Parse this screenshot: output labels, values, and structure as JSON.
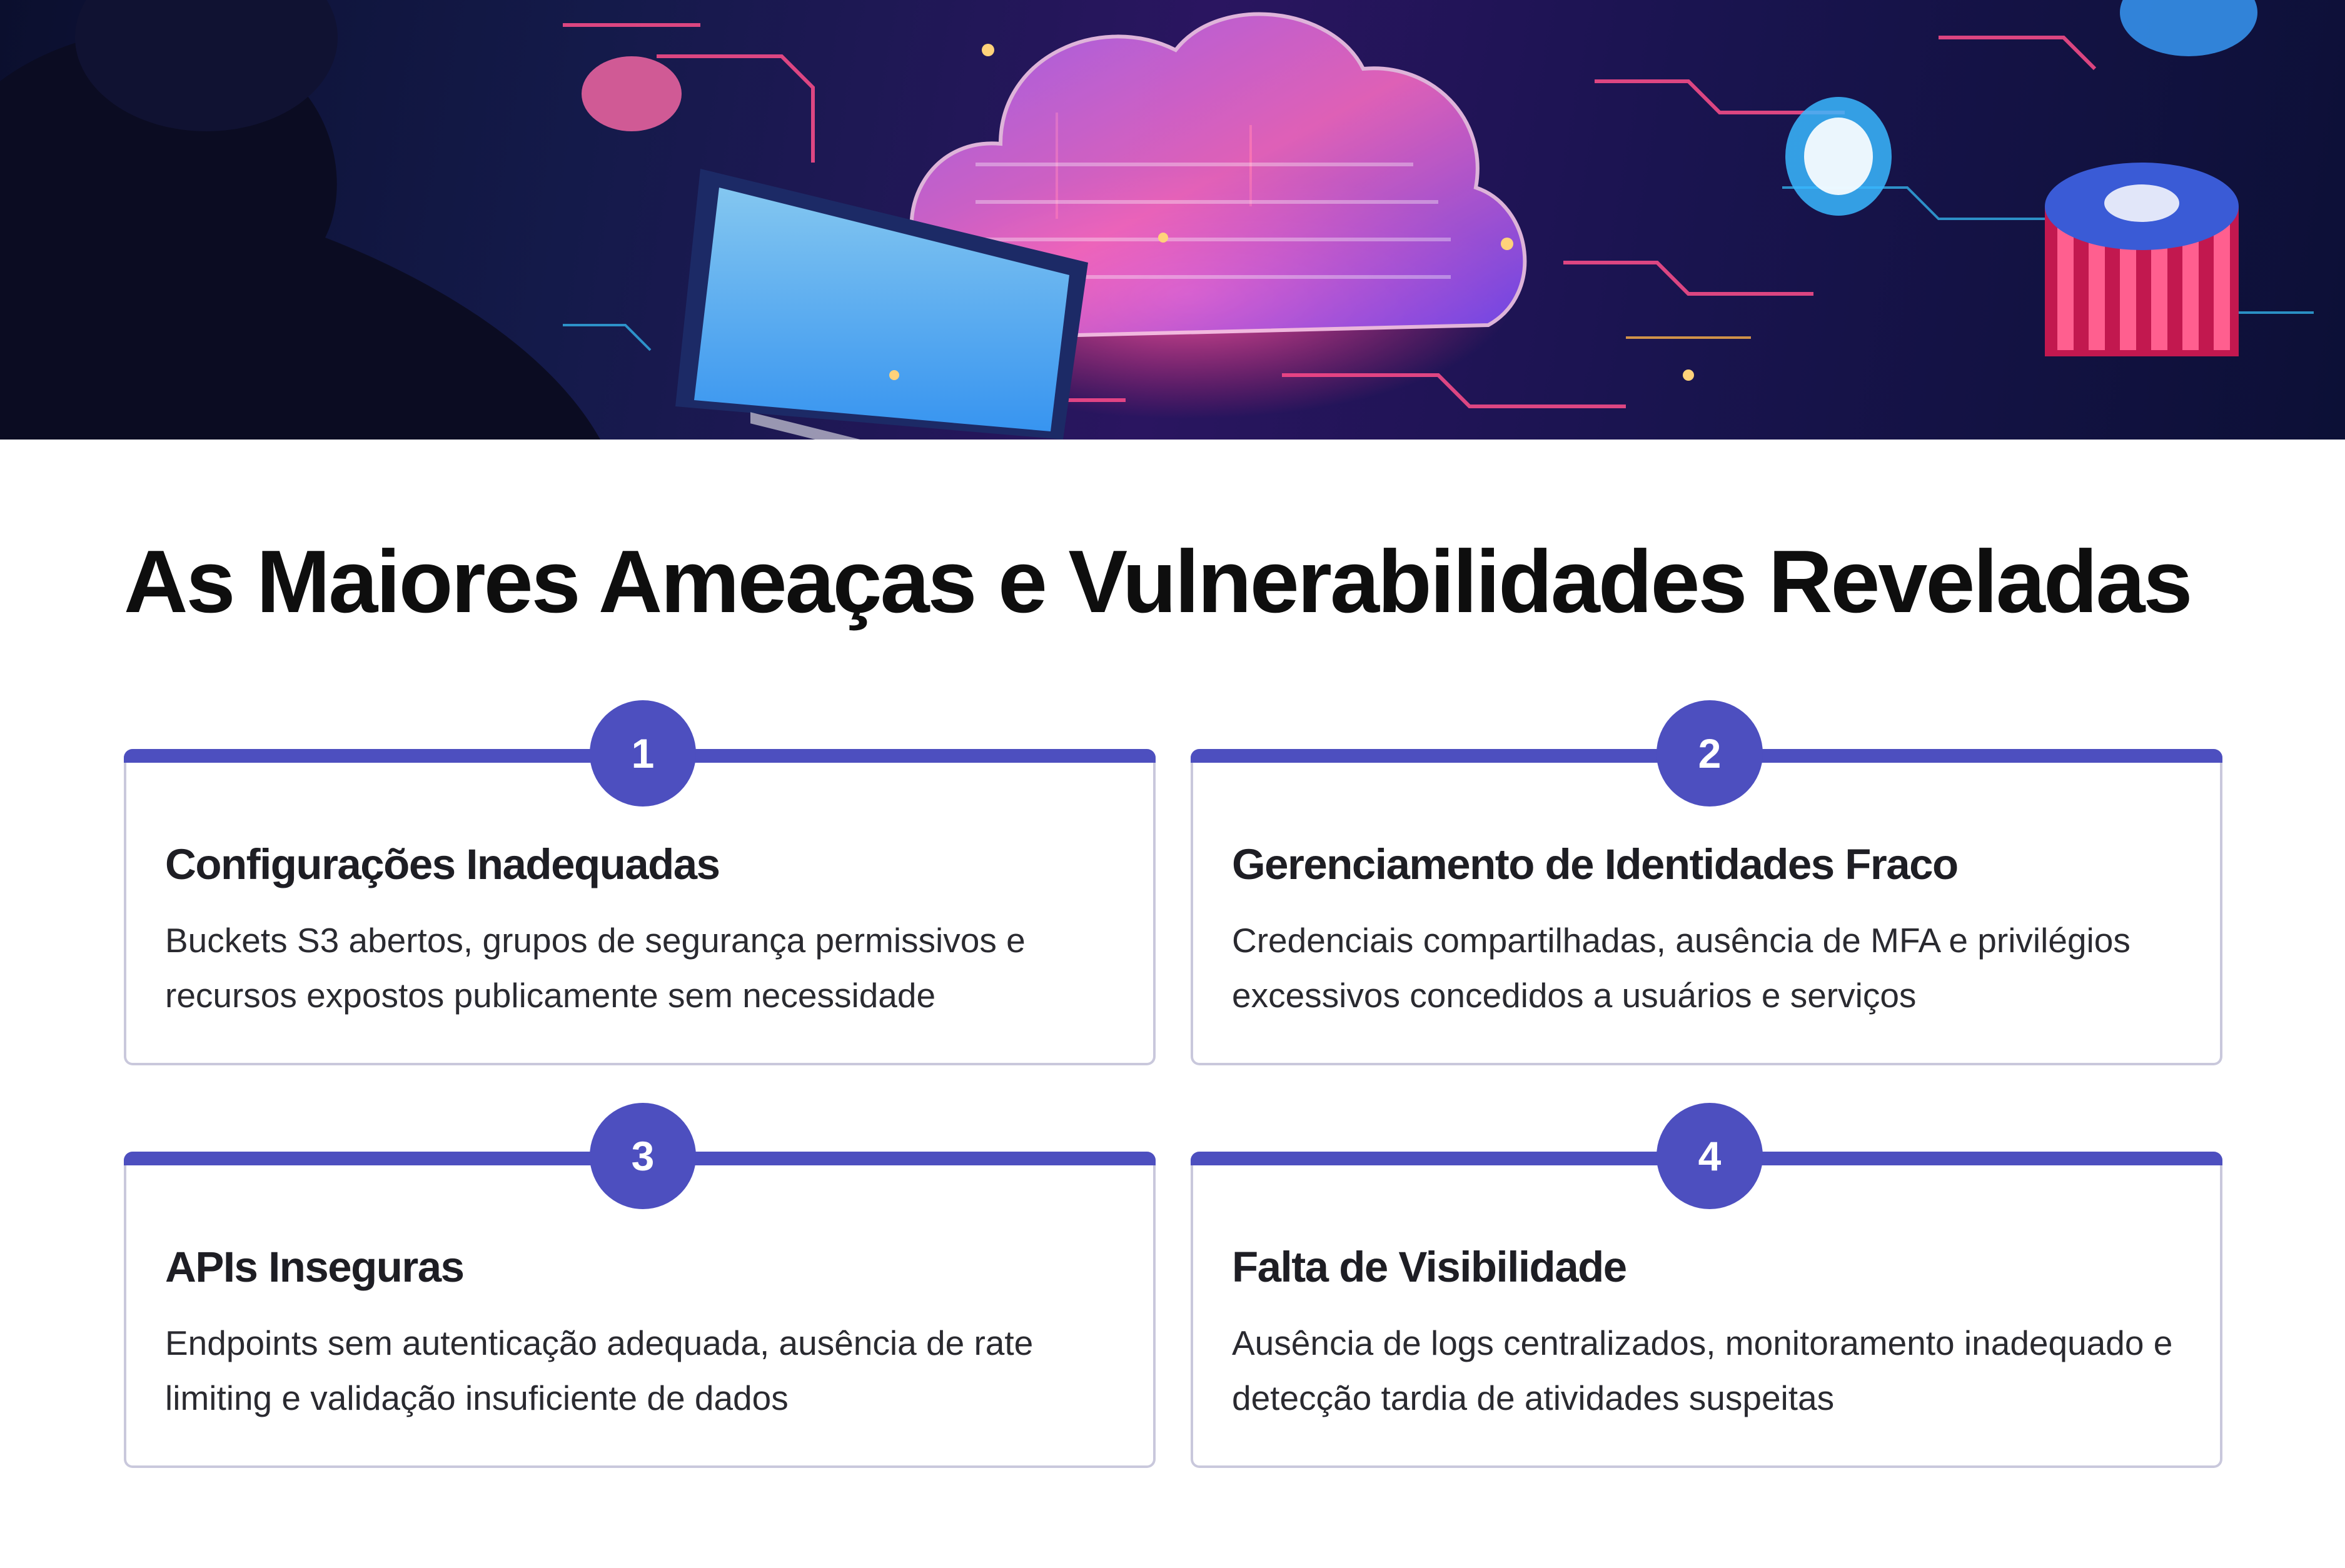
{
  "page": {
    "title": "As Maiores Ameaças e Vulnerabilidades Reveladas"
  },
  "colors": {
    "accent": "#4d4fbf",
    "card_border": "#c9c8dc",
    "title_text": "#0e0e0e",
    "body_text": "#2a2a30"
  },
  "cards": [
    {
      "number": "1",
      "title": "Configurações Inadequadas",
      "description": "Buckets S3 abertos, grupos de segurança permissivos e recursos expostos publicamente sem necessidade"
    },
    {
      "number": "2",
      "title": "Gerenciamento de Identidades Fraco",
      "description": "Credenciais compartilhadas, ausência de MFA e privilégios excessivos concedidos a usuários e serviços"
    },
    {
      "number": "3",
      "title": "APIs Inseguras",
      "description": "Endpoints sem autenticação adequada, ausência de rate limiting e validação insuficiente de dados"
    },
    {
      "number": "4",
      "title": "Falta de Visibilidade",
      "description": "Ausência de logs centralizados, monitoramento inadequado e detecção tardia de atividades suspeitas"
    }
  ]
}
